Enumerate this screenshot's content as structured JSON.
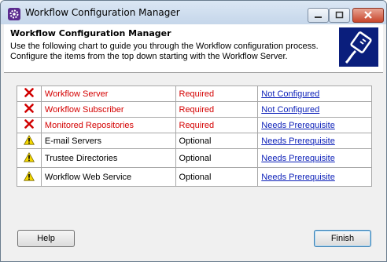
{
  "window": {
    "title": "Workflow Configuration Manager"
  },
  "header": {
    "title": "Workflow Configuration Manager",
    "description": "Use the following chart to guide you through the Workflow configuration process. Configure the items from the top down starting with the Workflow Server."
  },
  "rows": [
    {
      "icon": "error-x-icon",
      "name": "Workflow Server",
      "requirement": "Required",
      "status": "Not Configured"
    },
    {
      "icon": "error-x-icon",
      "name": "Workflow Subscriber",
      "requirement": "Required",
      "status": "Not Configured"
    },
    {
      "icon": "error-x-icon",
      "name": "Monitored Repositories",
      "requirement": "Required",
      "status": "Needs Prerequisite"
    },
    {
      "icon": "warning-icon",
      "name": "E-mail Servers",
      "requirement": "Optional",
      "status": "Needs Prerequisite"
    },
    {
      "icon": "warning-icon",
      "name": "Trustee Directories",
      "requirement": "Optional",
      "status": "Needs Prerequisite"
    },
    {
      "icon": "warning-icon",
      "name": "Workflow Web Service",
      "requirement": "Optional",
      "status": "Needs Prerequisite"
    }
  ],
  "buttons": {
    "help": "Help",
    "finish": "Finish"
  },
  "colors": {
    "required_text": "#d40000",
    "link": "#0b1fb8",
    "logo_bg": "#0a1e7c"
  }
}
